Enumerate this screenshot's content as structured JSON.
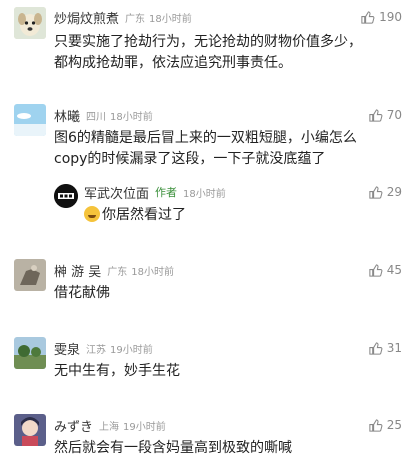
{
  "comments": [
    {
      "name": "炒焗炆煎煮",
      "location": "广东",
      "time": "18小时前",
      "likes": "190",
      "lines": [
        "只要实施了抢劫行为，无论抢劫的财物价值多少，",
        "都构成抢劫罪，依法应追究刑事责任。"
      ],
      "avatar_icon": "dog-avatar"
    },
    {
      "name": "林曦",
      "location": "四川",
      "time": "18小时前",
      "likes": "70",
      "lines": [
        "图6的精髓是最后冒上来的一双粗短腿，小编怎么",
        "copy的时候漏录了这段，一下子就没底蕴了"
      ],
      "avatar_icon": "sky-avatar",
      "reply": {
        "name": "军武次位面",
        "tag": "作者",
        "time": "18小时前",
        "likes": "29",
        "text": "你居然看过了",
        "emoji_icon": "laugh-emoji-icon",
        "avatar_icon": "junwu-logo-avatar"
      }
    },
    {
      "name": "榊 游 吴",
      "location": "广东",
      "time": "18小时前",
      "likes": "45",
      "lines": [
        "借花献佛"
      ],
      "avatar_icon": "hand-avatar"
    },
    {
      "name": "雯泉",
      "location": "江苏",
      "time": "19小时前",
      "likes": "31",
      "lines": [
        "无中生有，妙手生花"
      ],
      "avatar_icon": "landscape-avatar"
    },
    {
      "name": "みずき",
      "location": "上海",
      "time": "19小时前",
      "likes": "25",
      "lines": [
        "然后就会有一段含妈量高到极致的嘶喊"
      ],
      "avatar_icon": "anime-avatar"
    }
  ],
  "colors": {
    "author_tag": "#3a8f3a",
    "meta_gray": "#999999",
    "text": "#222222"
  }
}
